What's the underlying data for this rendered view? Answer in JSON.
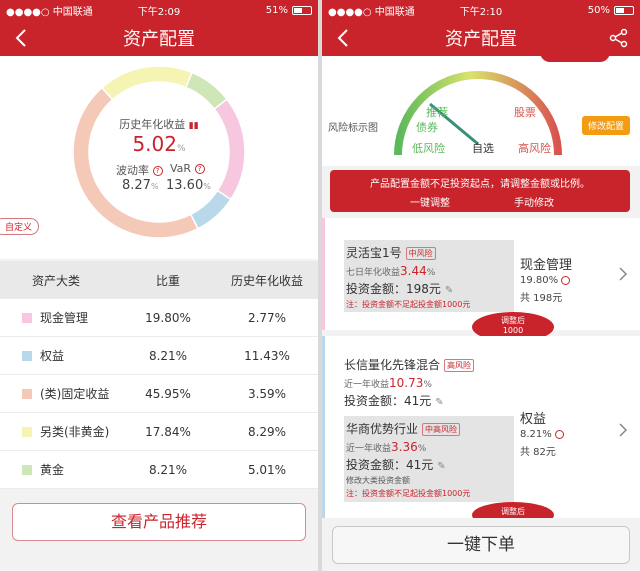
{
  "left": {
    "status": {
      "carrier": "●●●●○ 中国联通",
      "time": "下午2:09",
      "battery": "51%",
      "battery_level": 0.51
    },
    "title": "资产配置",
    "summary": {
      "hist_label": "历史年化收益",
      "hist_value": "5.02",
      "hist_unit": "%",
      "volatility_label": "波动率",
      "volatility_value": "8.27",
      "volatility_unit": "%",
      "var_label": "VaR",
      "var_value": "13.60",
      "var_unit": "%"
    },
    "custom_tag": "自定义",
    "donut": [
      {
        "name": "现金管理",
        "weight": 19.8,
        "color": "#f6c7df"
      },
      {
        "name": "权益",
        "weight": 8.21,
        "color": "#b9d9ea"
      },
      {
        "name": "(类)固定收益",
        "weight": 45.95,
        "color": "#f5c9b8"
      },
      {
        "name": "另类(非黄金)",
        "weight": 17.84,
        "color": "#f5f4b3"
      },
      {
        "name": "黄金",
        "weight": 8.21,
        "color": "#cfe7b6"
      }
    ],
    "table": {
      "headers": [
        "资产大类",
        "比重",
        "历史年化收益"
      ],
      "rows": [
        {
          "name": "现金管理",
          "weight": "19.80%",
          "ret": "2.77%",
          "color": "#f6c7df"
        },
        {
          "name": "权益",
          "weight": "8.21%",
          "ret": "11.43%",
          "color": "#b9d9ea"
        },
        {
          "name": "(类)固定收益",
          "weight": "45.95%",
          "ret": "3.59%",
          "color": "#f5c9b8"
        },
        {
          "name": "另类(非黄金)",
          "weight": "17.84%",
          "ret": "8.29%",
          "color": "#f5f4b3"
        },
        {
          "name": "黄金",
          "weight": "8.21%",
          "ret": "5.01%",
          "color": "#cfe7b6"
        }
      ]
    },
    "button": "查看产品推荐"
  },
  "right": {
    "status": {
      "carrier": "●●●●○ 中国联通",
      "time": "下午2:10",
      "battery": "50%",
      "battery_level": 0.5
    },
    "title": "资产配置",
    "gauge": {
      "risk_title": "风险标示图",
      "low": "低风险",
      "self": "自选",
      "high": "高风险",
      "bond": "债券",
      "recommend": "推荐",
      "stock": "股票",
      "adjust_button": "修改配置"
    },
    "warning": {
      "text": "产品配置金额不足投资起点，请调整金额或比例。",
      "action1": "一键调整",
      "action2": "手动修改"
    },
    "card1": {
      "product": "灵活宝1号",
      "risk": "中风险",
      "rate_label": "七日年化收益",
      "rate_value": "3.44",
      "rate_unit": "%",
      "amount_label": "投资金额：",
      "amount": "198元",
      "note": "注：投资金额不足起投金额1000元",
      "category": "现金管理",
      "cat_pct": "19.80%",
      "cat_total": "共 198元",
      "pill_label": "调整后",
      "pill_value": "1000"
    },
    "card2": {
      "p1_name": "长信量化先锋混合",
      "p1_risk": "高风险",
      "p1_rate_label": "近一年收益",
      "p1_rate_value": "10.73",
      "p1_rate_unit": "%",
      "p1_amount_label": "投资金额：",
      "p1_amount": "41元",
      "p2_name": "华商优势行业",
      "p2_risk": "中高风险",
      "p2_rate_label": "近一年收益",
      "p2_rate_value": "3.36",
      "p2_rate_unit": "%",
      "p2_amount_label": "投资金额：",
      "p2_amount": "41元",
      "p2_hint": "修改大类投资金额",
      "p2_note": "注：投资金额不足起投金额1000元",
      "category": "权益",
      "cat_pct": "8.21%",
      "cat_total": "共 82元",
      "pill_label": "调整后"
    },
    "button": "一键下单"
  }
}
